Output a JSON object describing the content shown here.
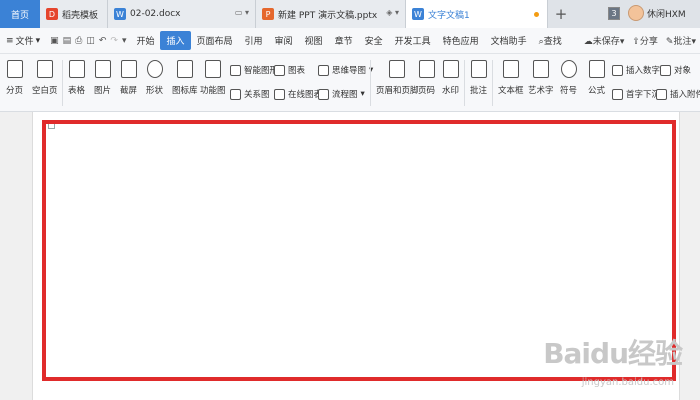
{
  "tabs": {
    "home": "首页",
    "documents": [
      {
        "label": "稻壳模板",
        "icon": "daoke-logo-icon",
        "color": "#e5452d"
      },
      {
        "label": "02-02.docx",
        "icon": "word-doc-icon",
        "color": "#3b82d6"
      },
      {
        "label": "新建 PPT 演示文稿.pptx",
        "icon": "ppt-doc-icon",
        "color": "#e5672d"
      },
      {
        "label": "文字文稿1",
        "icon": "word-doc-icon",
        "color": "#3b82d6"
      }
    ],
    "new_tab": "+",
    "window_count": "3",
    "username": "休闲HXM"
  },
  "menu": {
    "file": "文件",
    "items": [
      "开始",
      "插入",
      "页面布局",
      "引用",
      "审阅",
      "视图",
      "章节",
      "安全",
      "开发工具",
      "特色应用",
      "文档助手"
    ],
    "active": "插入",
    "search": "查找",
    "right": [
      "未保存",
      "分享",
      "批注"
    ]
  },
  "ribbon": {
    "big": [
      "分页",
      "空白页",
      "表格",
      "图片",
      "截屏",
      "形状",
      "图标库",
      "功能图",
      "页眉和页脚",
      "页码",
      "水印",
      "批注",
      "文本框",
      "艺术字",
      "符号",
      "公式"
    ],
    "small": [
      "智能图形",
      "图表",
      "思维导图",
      "关系图",
      "在线图表",
      "流程图",
      "插入数字",
      "对象",
      "首字下沉",
      "插入附件"
    ]
  },
  "accent_color": "#3b82d6",
  "highlight_color": "#e02b2b",
  "watermark": {
    "brand": "Baidu经验",
    "url": "jingyan.baidu.com"
  }
}
